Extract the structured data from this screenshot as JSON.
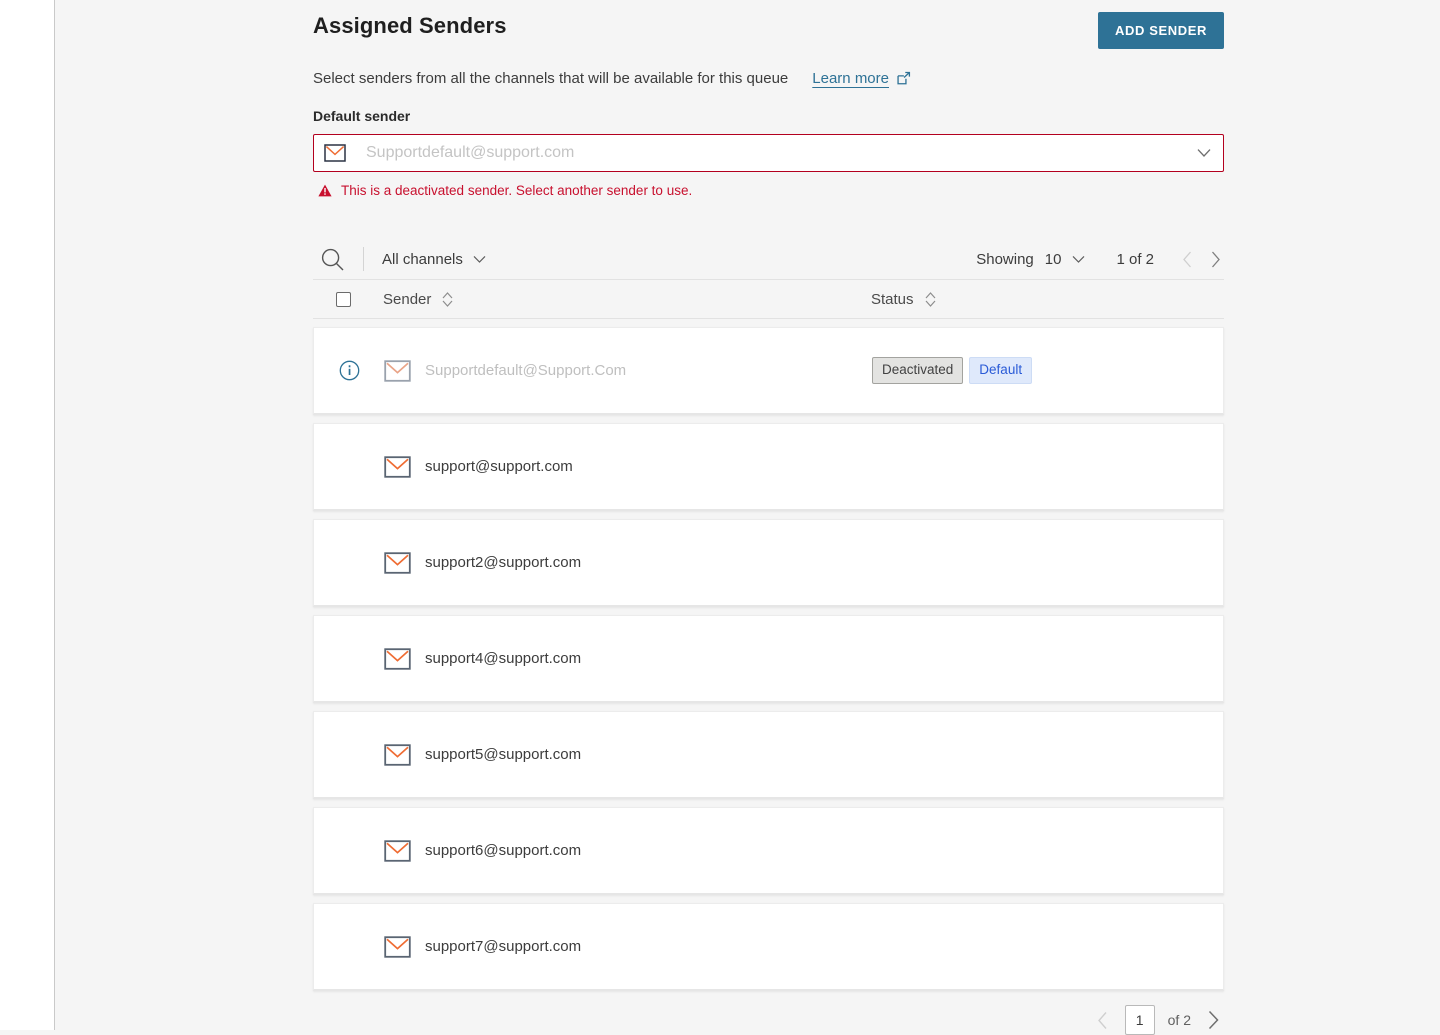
{
  "header": {
    "title": "Assigned Senders",
    "add_sender_label": "ADD SENDER",
    "subtitle": "Select senders from all the channels that will be available for this queue",
    "learn_more_label": "Learn more"
  },
  "default_sender": {
    "label": "Default sender",
    "value": "Supportdefault@support.com",
    "placeholder": "Supportdefault@support.com",
    "error_text": "This is a deactivated sender. Select another sender to use.",
    "error_color": "#c8102e",
    "border_color": "#b3001e"
  },
  "toolbar": {
    "channel_filter_label": "All channels",
    "showing_label": "Showing",
    "showing_count": "10",
    "page_indicator": "1 of 2"
  },
  "table": {
    "columns": {
      "sender": "Sender",
      "status": "Status"
    },
    "rows": [
      {
        "sender": "Supportdefault@Support.Com",
        "muted": true,
        "has_info_icon": true,
        "badges": [
          "Deactivated",
          "Default"
        ]
      },
      {
        "sender": "support@support.com",
        "muted": false,
        "has_info_icon": false,
        "badges": []
      },
      {
        "sender": "support2@support.com",
        "muted": false,
        "has_info_icon": false,
        "badges": []
      },
      {
        "sender": "support4@support.com",
        "muted": false,
        "has_info_icon": false,
        "badges": []
      },
      {
        "sender": "support5@support.com",
        "muted": false,
        "has_info_icon": false,
        "badges": []
      },
      {
        "sender": "support6@support.com",
        "muted": false,
        "has_info_icon": false,
        "badges": []
      },
      {
        "sender": "support7@support.com",
        "muted": false,
        "has_info_icon": false,
        "badges": []
      }
    ]
  },
  "pagination": {
    "current_page": "1",
    "of_label": "of 2"
  },
  "colors": {
    "accent": "#2e7296",
    "envelope_border": "#5a6573",
    "envelope_flap": "#ef6c33",
    "info_icon": "#2e7296",
    "badge_default_text": "#2a5bd7"
  },
  "icons": {
    "search": "search-icon",
    "envelope": "envelope-icon",
    "info": "info-icon",
    "external_link": "external-link-icon",
    "warning": "warning-triangle-icon",
    "chevron_down": "chevron-down-icon",
    "sort": "sort-icon",
    "prev": "chevron-left-icon",
    "next": "chevron-right-icon"
  }
}
